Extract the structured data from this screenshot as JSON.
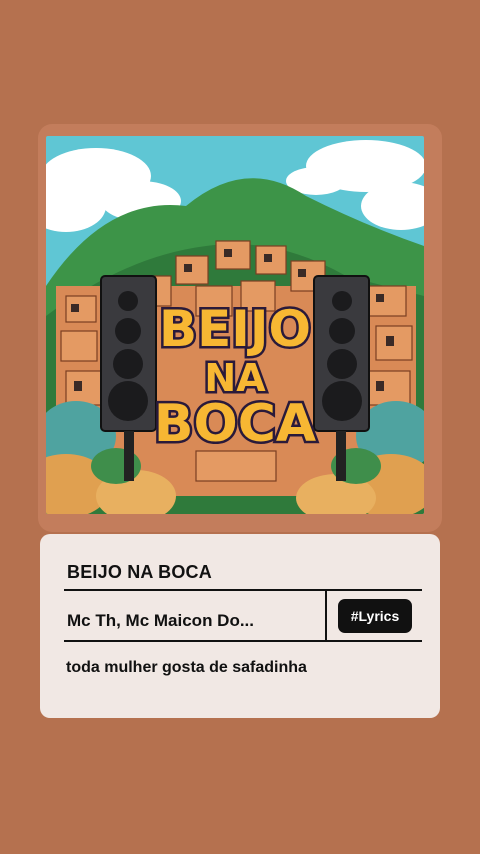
{
  "song": {
    "title": "BEIJO NA BOCA",
    "artist": "Mc Th, Mc Maicon Do...",
    "lyric_line": "toda mulher gosta de safadinha"
  },
  "actions": {
    "lyrics_label": "#Lyrics"
  },
  "cover": {
    "lettering": [
      "BEIJO",
      "NA",
      "BOCA"
    ]
  },
  "colors": {
    "background": "#b5714f",
    "card": "#f1e8e4",
    "button": "#111111"
  }
}
